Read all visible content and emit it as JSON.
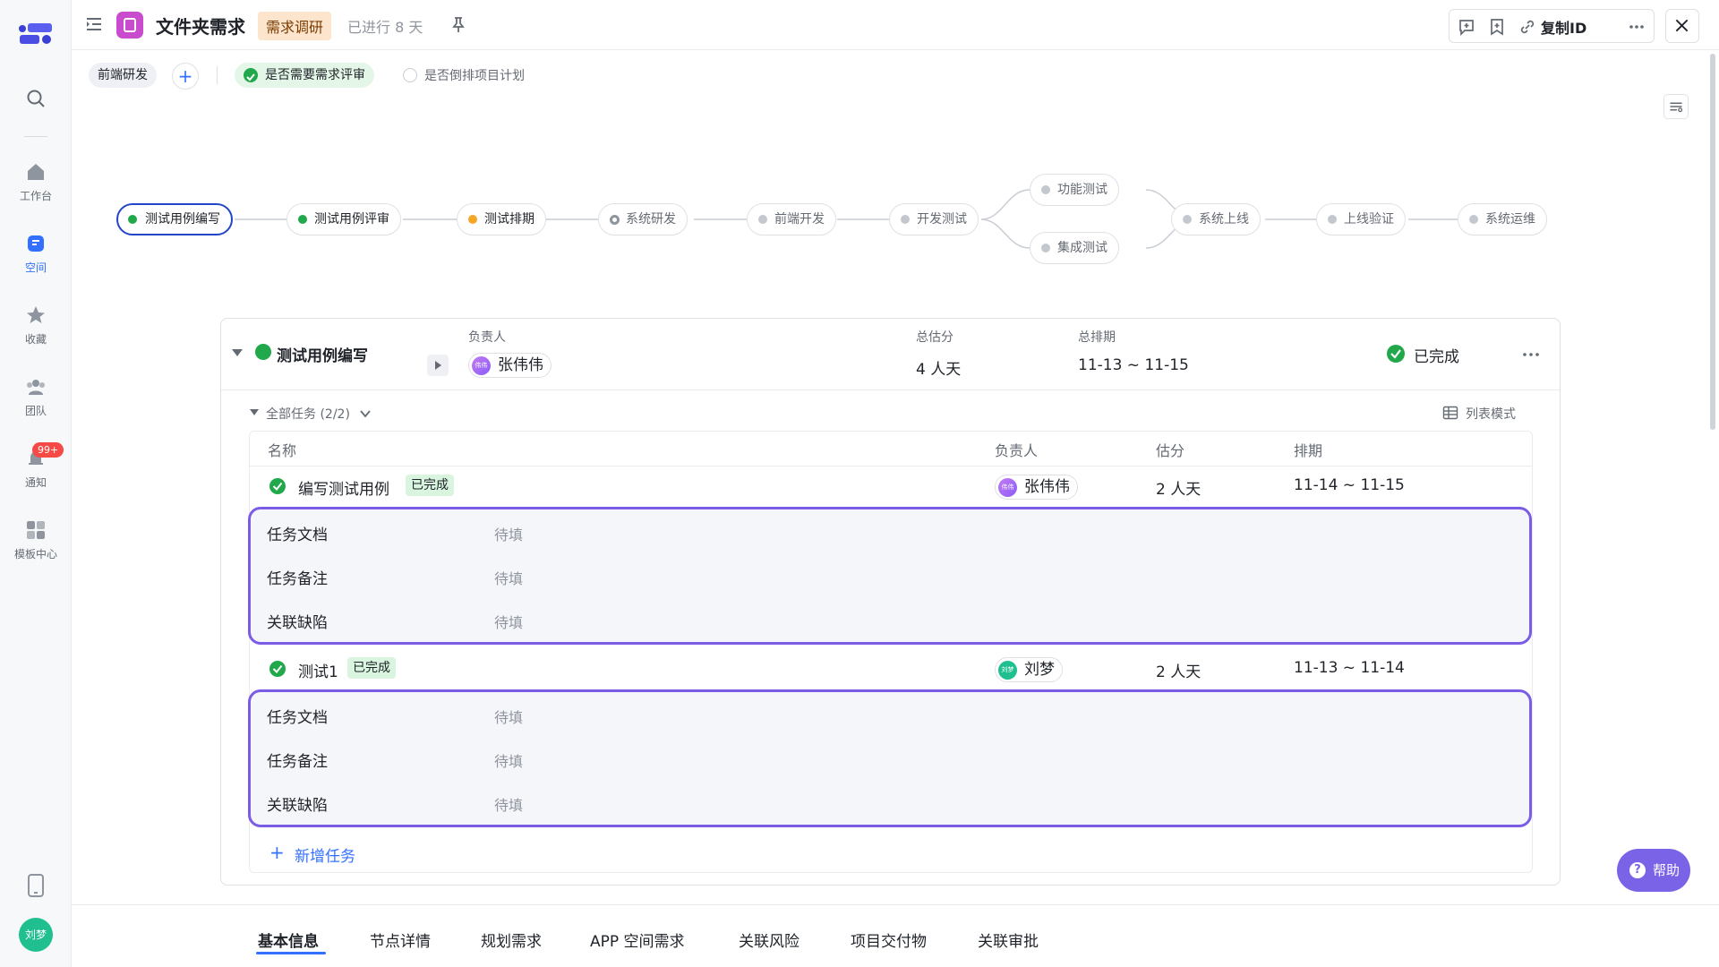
{
  "rail": {
    "items": [
      {
        "label": "",
        "icon": "search-icon"
      },
      {
        "label": "工作台",
        "icon": "home-icon"
      },
      {
        "label": "空间",
        "icon": "space-icon",
        "active": true
      },
      {
        "label": "收藏",
        "icon": "star-icon"
      },
      {
        "label": "团队",
        "icon": "team-icon"
      },
      {
        "label": "通知",
        "icon": "bell-icon",
        "badge": "99+"
      },
      {
        "label": "模板中心",
        "icon": "grid-icon"
      }
    ],
    "user_avatar": "刘梦"
  },
  "header": {
    "title": "文件夹需求",
    "stage_tag": "需求调研",
    "elapsed": "已进行 8 天",
    "copy_id_label": "复制ID"
  },
  "subbar": {
    "chip": "前端研发",
    "add": "+",
    "review_option": "是否需要需求评审",
    "plan_option": "是否倒排项目计划"
  },
  "flow": {
    "nodes": [
      {
        "label": "测试用例编写",
        "status": "done"
      },
      {
        "label": "测试用例评审",
        "status": "done"
      },
      {
        "label": "测试排期",
        "status": "wait"
      },
      {
        "label": "系统研发",
        "status": "progress"
      },
      {
        "label": "前端开发",
        "status": "todo"
      },
      {
        "label": "开发测试",
        "status": "todo"
      },
      {
        "label": "功能测试",
        "status": "todo"
      },
      {
        "label": "集成测试",
        "status": "todo"
      },
      {
        "label": "系统上线",
        "status": "todo"
      },
      {
        "label": "上线验证",
        "status": "todo"
      },
      {
        "label": "系统运维",
        "status": "todo"
      }
    ]
  },
  "stage": {
    "name": "测试用例编写",
    "owner_label": "负责人",
    "owner": "张伟伟",
    "owner_avatar": "伟伟",
    "estimate_label": "总估分",
    "estimate": "4 人天",
    "schedule_label": "总排期",
    "schedule": "11-13 ~ 11-15",
    "status": "已完成"
  },
  "tasks": {
    "summary": "全部任务 (2/2)",
    "list_mode": "列表模式",
    "columns": [
      "名称",
      "负责人",
      "估分",
      "排期"
    ],
    "rows": [
      {
        "name": "编写测试用例",
        "status": "已完成",
        "owner": "张伟伟",
        "owner_avatar": "伟伟",
        "estimate": "2 人天",
        "schedule": "11-14 ~ 11-15",
        "details": [
          {
            "label": "任务文档",
            "value": "待填"
          },
          {
            "label": "任务备注",
            "value": "待填"
          },
          {
            "label": "关联缺陷",
            "value": "待填"
          }
        ]
      },
      {
        "name": "测试1",
        "status": "已完成",
        "owner": "刘梦",
        "owner_avatar": "刘梦",
        "estimate": "2 人天",
        "schedule": "11-13 ~ 11-14",
        "details": [
          {
            "label": "任务文档",
            "value": "待填"
          },
          {
            "label": "任务备注",
            "value": "待填"
          },
          {
            "label": "关联缺陷",
            "value": "待填"
          }
        ]
      }
    ],
    "add_label": "新增任务"
  },
  "bottom_tabs": [
    "基本信息",
    "节点详情",
    "规划需求",
    "APP 空间需求",
    "关联风险",
    "项目交付物",
    "关联审批"
  ],
  "help_label": "帮助",
  "colors": {
    "accent": "#3370ff",
    "success": "#21a84b",
    "highlight": "#7b5ce6",
    "help": "#7b63e8"
  }
}
